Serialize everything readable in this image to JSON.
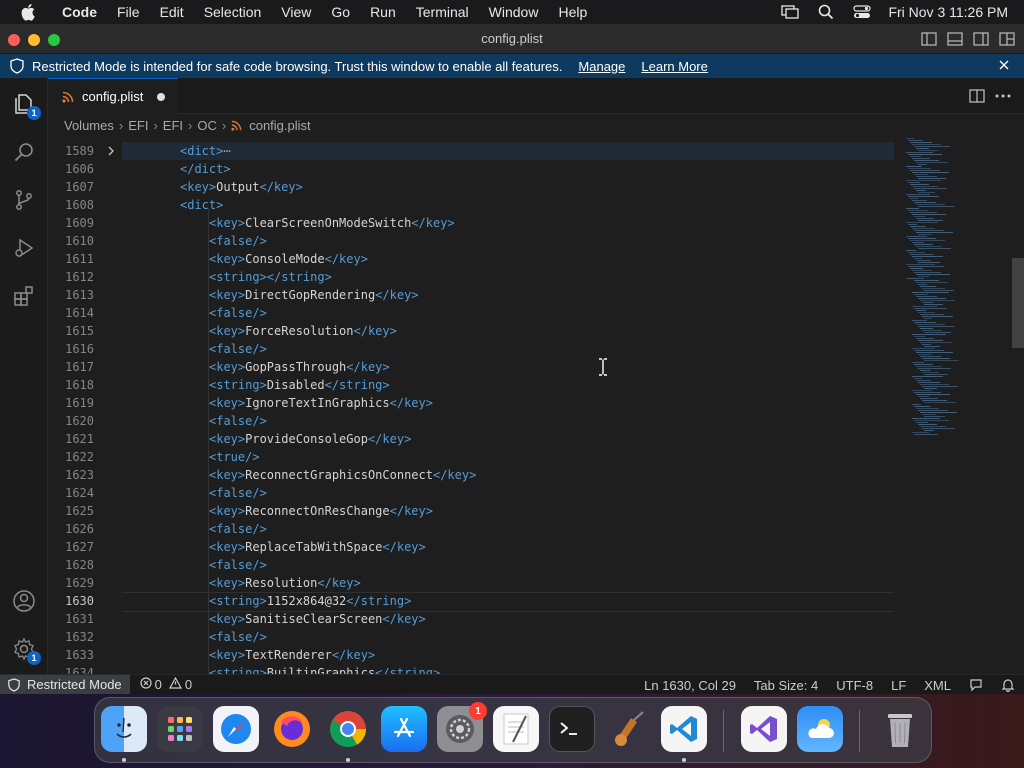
{
  "menubar": {
    "app_name": "Code",
    "items": [
      "File",
      "Edit",
      "Selection",
      "View",
      "Go",
      "Run",
      "Terminal",
      "Window",
      "Help"
    ],
    "clock": "Fri Nov 3  11:26 PM"
  },
  "window": {
    "title": "config.plist"
  },
  "banner": {
    "message": "Restricted Mode is intended for safe code browsing. Trust this window to enable all features.",
    "manage": "Manage",
    "learn_more": "Learn More"
  },
  "activitybar": {
    "explorer_badge": "1",
    "settings_badge": "1"
  },
  "tab": {
    "filename": "config.plist"
  },
  "breadcrumb": [
    "Volumes",
    "EFI",
    "EFI",
    "OC",
    "config.plist"
  ],
  "editor": {
    "lines": [
      {
        "n": "1589",
        "indent": 2,
        "parts": [
          [
            "tag",
            "<dict>"
          ],
          [
            "ell",
            "⋯"
          ]
        ],
        "folded": true
      },
      {
        "n": "1606",
        "indent": 2,
        "parts": [
          [
            "tag",
            "</dict>"
          ]
        ]
      },
      {
        "n": "1607",
        "indent": 2,
        "parts": [
          [
            "tag",
            "<key>"
          ],
          [
            "txt",
            "Output"
          ],
          [
            "tag",
            "</key>"
          ]
        ]
      },
      {
        "n": "1608",
        "indent": 2,
        "parts": [
          [
            "tag",
            "<dict>"
          ]
        ]
      },
      {
        "n": "1609",
        "indent": 3,
        "parts": [
          [
            "tag",
            "<key>"
          ],
          [
            "txt",
            "ClearScreenOnModeSwitch"
          ],
          [
            "tag",
            "</key>"
          ]
        ]
      },
      {
        "n": "1610",
        "indent": 3,
        "parts": [
          [
            "tag",
            "<false/>"
          ]
        ]
      },
      {
        "n": "1611",
        "indent": 3,
        "parts": [
          [
            "tag",
            "<key>"
          ],
          [
            "txt",
            "ConsoleMode"
          ],
          [
            "tag",
            "</key>"
          ]
        ]
      },
      {
        "n": "1612",
        "indent": 3,
        "parts": [
          [
            "tag",
            "<string></string>"
          ]
        ]
      },
      {
        "n": "1613",
        "indent": 3,
        "parts": [
          [
            "tag",
            "<key>"
          ],
          [
            "txt",
            "DirectGopRendering"
          ],
          [
            "tag",
            "</key>"
          ]
        ]
      },
      {
        "n": "1614",
        "indent": 3,
        "parts": [
          [
            "tag",
            "<false/>"
          ]
        ]
      },
      {
        "n": "1615",
        "indent": 3,
        "parts": [
          [
            "tag",
            "<key>"
          ],
          [
            "txt",
            "ForceResolution"
          ],
          [
            "tag",
            "</key>"
          ]
        ]
      },
      {
        "n": "1616",
        "indent": 3,
        "parts": [
          [
            "tag",
            "<false/>"
          ]
        ]
      },
      {
        "n": "1617",
        "indent": 3,
        "parts": [
          [
            "tag",
            "<key>"
          ],
          [
            "txt",
            "GopPassThrough"
          ],
          [
            "tag",
            "</key>"
          ]
        ]
      },
      {
        "n": "1618",
        "indent": 3,
        "parts": [
          [
            "tag",
            "<string>"
          ],
          [
            "txt",
            "Disabled"
          ],
          [
            "tag",
            "</string>"
          ]
        ]
      },
      {
        "n": "1619",
        "indent": 3,
        "parts": [
          [
            "tag",
            "<key>"
          ],
          [
            "txt",
            "IgnoreTextInGraphics"
          ],
          [
            "tag",
            "</key>"
          ]
        ]
      },
      {
        "n": "1620",
        "indent": 3,
        "parts": [
          [
            "tag",
            "<false/>"
          ]
        ]
      },
      {
        "n": "1621",
        "indent": 3,
        "parts": [
          [
            "tag",
            "<key>"
          ],
          [
            "txt",
            "ProvideConsoleGop"
          ],
          [
            "tag",
            "</key>"
          ]
        ]
      },
      {
        "n": "1622",
        "indent": 3,
        "parts": [
          [
            "tag",
            "<true/>"
          ]
        ]
      },
      {
        "n": "1623",
        "indent": 3,
        "parts": [
          [
            "tag",
            "<key>"
          ],
          [
            "txt",
            "ReconnectGraphicsOnConnect"
          ],
          [
            "tag",
            "</key>"
          ]
        ]
      },
      {
        "n": "1624",
        "indent": 3,
        "parts": [
          [
            "tag",
            "<false/>"
          ]
        ]
      },
      {
        "n": "1625",
        "indent": 3,
        "parts": [
          [
            "tag",
            "<key>"
          ],
          [
            "txt",
            "ReconnectOnResChange"
          ],
          [
            "tag",
            "</key>"
          ]
        ]
      },
      {
        "n": "1626",
        "indent": 3,
        "parts": [
          [
            "tag",
            "<false/>"
          ]
        ]
      },
      {
        "n": "1627",
        "indent": 3,
        "parts": [
          [
            "tag",
            "<key>"
          ],
          [
            "txt",
            "ReplaceTabWithSpace"
          ],
          [
            "tag",
            "</key>"
          ]
        ]
      },
      {
        "n": "1628",
        "indent": 3,
        "parts": [
          [
            "tag",
            "<false/>"
          ]
        ]
      },
      {
        "n": "1629",
        "indent": 3,
        "parts": [
          [
            "tag",
            "<key>"
          ],
          [
            "txt",
            "Resolution"
          ],
          [
            "tag",
            "</key>"
          ]
        ]
      },
      {
        "n": "1630",
        "indent": 3,
        "parts": [
          [
            "tag",
            "<string>"
          ],
          [
            "txt",
            "1152x864@32"
          ],
          [
            "tag",
            "</string>"
          ]
        ],
        "current": true
      },
      {
        "n": "1631",
        "indent": 3,
        "parts": [
          [
            "tag",
            "<key>"
          ],
          [
            "txt",
            "SanitiseClearScreen"
          ],
          [
            "tag",
            "</key>"
          ]
        ]
      },
      {
        "n": "1632",
        "indent": 3,
        "parts": [
          [
            "tag",
            "<false/>"
          ]
        ]
      },
      {
        "n": "1633",
        "indent": 3,
        "parts": [
          [
            "tag",
            "<key>"
          ],
          [
            "txt",
            "TextRenderer"
          ],
          [
            "tag",
            "</key>"
          ]
        ]
      },
      {
        "n": "1634",
        "indent": 3,
        "parts": [
          [
            "tag",
            "<string>"
          ],
          [
            "txt",
            "BuiltinGraphics"
          ],
          [
            "tag",
            "</string>"
          ]
        ]
      }
    ]
  },
  "statusbar": {
    "restricted": "Restricted Mode",
    "errors": "0",
    "warnings": "0",
    "position": "Ln 1630, Col 29",
    "tab_size": "Tab Size: 4",
    "encoding": "UTF-8",
    "eol": "LF",
    "language": "XML"
  },
  "dock": {
    "apps": [
      "finder",
      "launchpad",
      "safari",
      "firefox",
      "chrome",
      "app-store",
      "system-settings",
      "textedit",
      "terminal",
      "instruments",
      "vscode",
      "visual-studio",
      "weather",
      "trash"
    ],
    "settings_badge": "1"
  },
  "colors": {
    "accent": "#0e63c4",
    "tag": "#569cd6",
    "text": "#d4d4d4",
    "banner": "#0e3a5f"
  }
}
